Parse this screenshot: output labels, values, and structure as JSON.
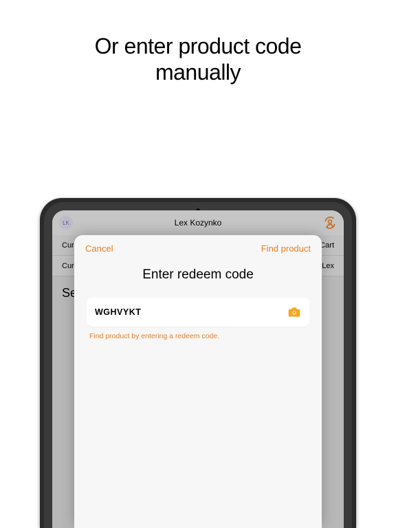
{
  "promo": {
    "title_line1": "Or enter product code",
    "title_line2": "manually"
  },
  "bg_header": {
    "user_name": "Lex Kozynko",
    "avatar_initials": "LK"
  },
  "bg_rows": {
    "row1_left": "Curre",
    "row1_right": "Cart",
    "row2_left": "Curre",
    "row2_right": "Lex"
  },
  "bg_section_title": "Se",
  "modal": {
    "cancel_label": "Cancel",
    "find_label": "Find product",
    "title": "Enter redeem code",
    "input_value": "WGHVYKT",
    "hint": "Find product by entering a redeem code."
  },
  "colors": {
    "accent": "#e67e22",
    "camera_icon": "#f5a623"
  }
}
